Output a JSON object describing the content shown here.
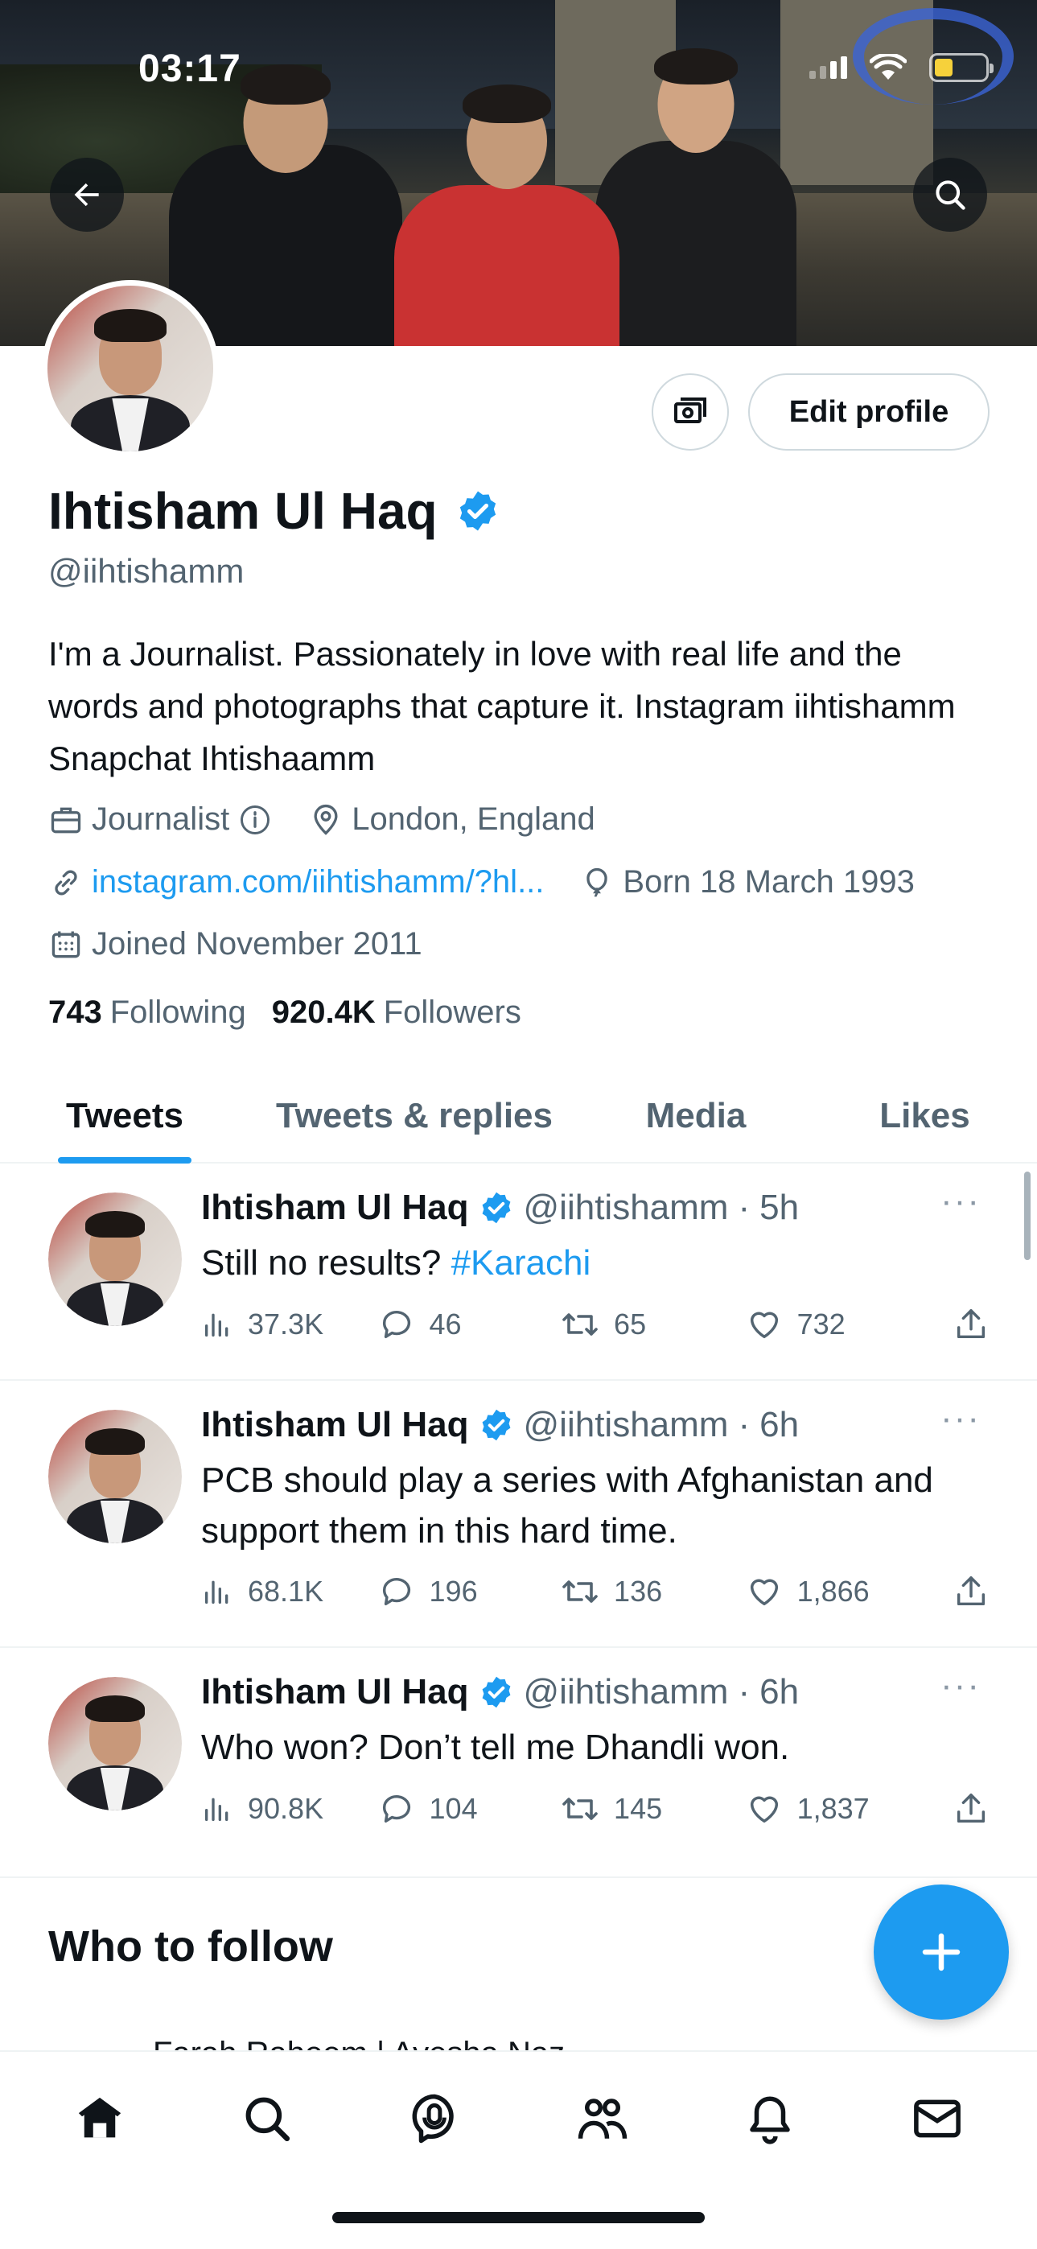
{
  "status_bar": {
    "time": "03:17"
  },
  "profile": {
    "name": "Ihtisham Ul Haq",
    "handle": "@iihtishamm",
    "edit_button": "Edit profile",
    "bio": "I'm a Journalist. Passionately in love with real life and the words and photographs that capture it. Instagram iihtishamm Snapchat Ihtishaamm",
    "profession": "Journalist",
    "location": "London, England",
    "website": "instagram.com/iihtishamm/?hl...",
    "birthday": "Born 18 March 1993",
    "joined": "Joined November 2011",
    "following_count": "743",
    "following_label": "Following",
    "followers_count": "920.4K",
    "followers_label": "Followers"
  },
  "tabs": [
    {
      "label": "Tweets",
      "active": true
    },
    {
      "label": "Tweets & replies",
      "active": false
    },
    {
      "label": "Media",
      "active": false
    },
    {
      "label": "Likes",
      "active": false
    }
  ],
  "tweets": [
    {
      "name": "Ihtisham Ul Haq",
      "handle": "@iihtishamm",
      "dot": "·",
      "time": "5h",
      "text": "Still no results? ",
      "hashtag": "#Karachi",
      "views": "37.3K",
      "replies": "46",
      "retweets": "65",
      "likes": "732"
    },
    {
      "name": "Ihtisham Ul Haq",
      "handle": "@iihtishamm",
      "dot": "·",
      "time": "6h",
      "text": "PCB should play a series with Afghanistan and support them in this hard time.",
      "hashtag": "",
      "views": "68.1K",
      "replies": "196",
      "retweets": "136",
      "likes": "1,866"
    },
    {
      "name": "Ihtisham Ul Haq",
      "handle": "@iihtishamm",
      "dot": "·",
      "time": "6h",
      "text": "Who won? Don’t tell me Dhandli won.",
      "hashtag": "",
      "views": "90.8K",
      "replies": "104",
      "retweets": "145",
      "likes": "1,837"
    }
  ],
  "who_to_follow": {
    "title": "Who to follow",
    "peek_text": "Farah Raheem | Ayesha Naz ..."
  },
  "more_glyph": "···",
  "fab": {
    "icon": "plus-icon"
  },
  "bottom_nav": [
    "home-icon",
    "search-icon",
    "spaces-icon",
    "communities-icon",
    "notifications-icon",
    "messages-icon"
  ],
  "colors": {
    "accent": "#1d9bf0",
    "text": "#0f1419",
    "secondary": "#536471",
    "divider": "#eff3f4"
  }
}
